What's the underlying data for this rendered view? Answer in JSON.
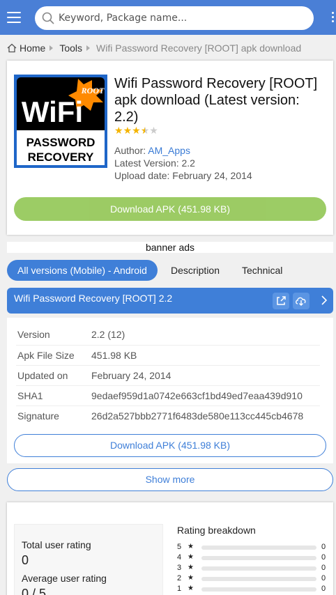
{
  "header": {
    "search_placeholder": "Keyword, Package name..."
  },
  "breadcrumb": {
    "home": "Home",
    "category": "Tools",
    "current": "Wifi Password Recovery [ROOT] apk download"
  },
  "app": {
    "title": "Wifi Password Recovery [ROOT] apk download (Latest version: 2.2)",
    "rating_stars": 3.5,
    "author_label": "Author: ",
    "author_name": "AM_Apps",
    "latest_version": "Latest Version: 2.2",
    "upload_date": "Upload date: February 24, 2014",
    "download_button": "Download APK (451.98 KB)",
    "icon_text": {
      "logo": "WiFi",
      "badge": "ROOT",
      "line1": "PASSWORD",
      "line2": "RECOVERY"
    }
  },
  "banner": "banner ads",
  "tabs": [
    {
      "label": "All versions (Mobile) - Android",
      "active": true
    },
    {
      "label": "Description",
      "active": false
    },
    {
      "label": "Technical",
      "active": false
    }
  ],
  "version": {
    "header": "Wifi Password Recovery [ROOT] 2.2",
    "details": [
      {
        "key": "Version",
        "value": "2.2 (12)"
      },
      {
        "key": "Apk File Size",
        "value": "451.98 KB"
      },
      {
        "key": "Updated on",
        "value": "February 24, 2014"
      },
      {
        "key": "SHA1",
        "value": "9edaef959d1a0742e663cf1bd49ed7eaa439d910"
      },
      {
        "key": "Signature",
        "value": "26d2a527bbb2771f6483de580e113cc445cb4678"
      }
    ],
    "download_button": "Download APK (451.98 KB)"
  },
  "show_more": "Show more",
  "rating": {
    "total_label": "Total user rating",
    "total_value": "0",
    "average_label": "Average user rating",
    "average_value": "0 / 5",
    "breakdown_title": "Rating breakdown",
    "breakdown": [
      {
        "stars": "5",
        "count": "0",
        "fraction": 0
      },
      {
        "stars": "4",
        "count": "0",
        "fraction": 0
      },
      {
        "stars": "3",
        "count": "0",
        "fraction": 0
      },
      {
        "stars": "2",
        "count": "0",
        "fraction": 0
      },
      {
        "stars": "1",
        "count": "0",
        "fraction": 0
      }
    ]
  },
  "colors": {
    "primary": "#3f7fd8",
    "header": "#4a7fd6",
    "download": "#8bc34a",
    "star": "#f4b400"
  }
}
